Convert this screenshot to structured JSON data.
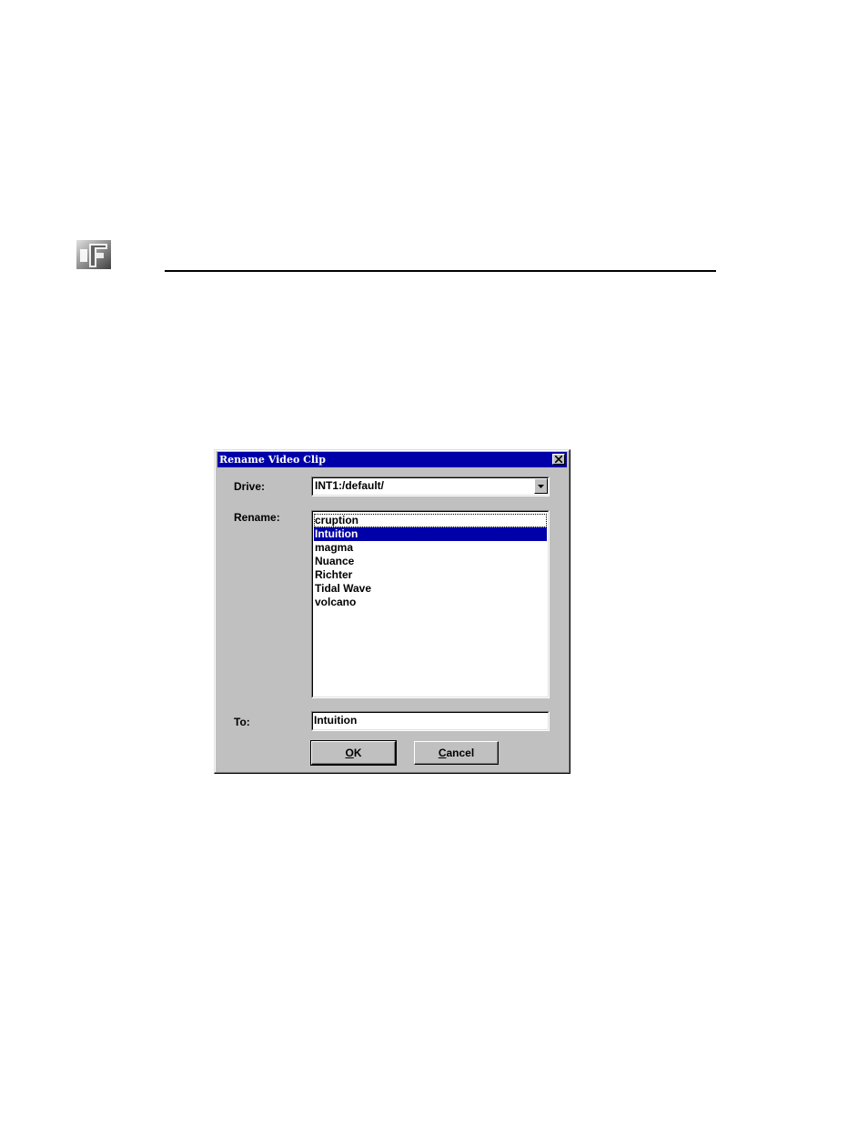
{
  "dialog": {
    "title": "Rename Video Clip",
    "drive_label": "Drive:",
    "drive_value": "INT1:/default/",
    "rename_label": "Rename:",
    "clips": [
      "cruption",
      "Intuition",
      "magma",
      "Nuance",
      "Richter",
      "Tidal Wave",
      "volcano"
    ],
    "selected_index": 1,
    "to_label": "To:",
    "to_value": "Intuition",
    "ok_mnemonic": "O",
    "ok_rest": "K",
    "cancel_mnemonic": "C",
    "cancel_rest": "ancel"
  },
  "icons": {
    "logo": "product-logo-icon",
    "close": "close-icon",
    "dropdown": "chevron-down-icon"
  },
  "colors": {
    "titlebar": "#0000a8",
    "selection": "#0000a8",
    "dialog_bg": "#c0c0c0"
  }
}
